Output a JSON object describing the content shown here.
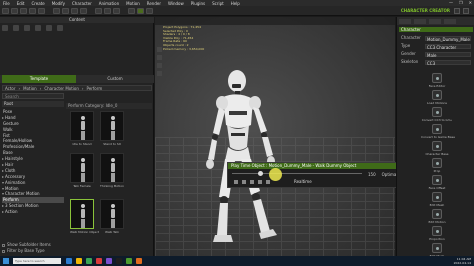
{
  "titlebar": {
    "menus": [
      "File",
      "Edit",
      "Create",
      "Modify",
      "Character",
      "Animation",
      "Motion",
      "Render",
      "Window",
      "Plugins",
      "Script",
      "Help"
    ],
    "window_buttons": [
      "—",
      "❐",
      "✕"
    ]
  },
  "toolbar": {
    "brand": "CHARACTER CREATOR"
  },
  "left_panel": {
    "title": "Content",
    "tabs": [
      "Template",
      "Custom"
    ],
    "breadcrumb": [
      "Actor",
      "Motion",
      "Character Motion",
      "Perform"
    ],
    "search_placeholder": "Search",
    "tree_header": "Root",
    "tree": [
      {
        "label": "Pose",
        "arrow": "",
        "selected": false
      },
      {
        "label": "Hand",
        "arrow": "▸",
        "selected": false
      },
      {
        "label": "Gesture",
        "arrow": "",
        "selected": false
      },
      {
        "label": "Walk",
        "arrow": "",
        "selected": false
      },
      {
        "label": "Fist",
        "arrow": "",
        "selected": false
      },
      {
        "label": "Female/Hollow",
        "arrow": "",
        "selected": false
      },
      {
        "label": "Profession/Male",
        "arrow": "",
        "selected": false
      },
      {
        "label": "Base",
        "arrow": "",
        "selected": false
      },
      {
        "label": "Hairstyle",
        "arrow": "▸",
        "selected": false
      },
      {
        "label": "Hair",
        "arrow": "▸",
        "selected": false
      },
      {
        "label": "Cloth",
        "arrow": "▸",
        "selected": false
      },
      {
        "label": "Accessory",
        "arrow": "▸",
        "selected": false
      },
      {
        "label": "Animation",
        "arrow": "▾",
        "selected": false
      },
      {
        "label": "Motion",
        "arrow": "▾",
        "selected": false
      },
      {
        "label": "Character Motion",
        "arrow": "▾",
        "selected": false
      },
      {
        "label": "Perform",
        "arrow": "",
        "selected": true
      },
      {
        "label": "3 Section Motion",
        "arrow": "▸",
        "selected": false
      },
      {
        "label": "Action",
        "arrow": "▸",
        "selected": false
      }
    ],
    "sub_breadcrumb": "Perform Category: Idle_0",
    "thumbs": [
      {
        "caption": "Idle to Stand",
        "selected": false
      },
      {
        "caption": "Stand to Sit",
        "selected": false
      },
      {
        "caption": "Talk Female",
        "selected": false
      },
      {
        "caption": "Thinking Motion",
        "selected": false
      },
      {
        "caption": "Walk Motion Object",
        "selected": true
      },
      {
        "caption": "Walk Talk",
        "selected": false
      }
    ],
    "checks": [
      "Show Subfolder Items",
      "Filter by Base Type"
    ]
  },
  "viewport": {
    "info_lines": [
      "Project Polygons : 71,454",
      "Selected Poly : 0",
      "Shaders : 4 / 9 / 8",
      "Visible Poly : 71,454",
      "Frame Rate : 60",
      "Objects count : 2",
      "Picked memory : 3,654,000"
    ]
  },
  "timeline": {
    "title": "Play Time Object : Motion_Dummy_Male - Walk Dummy Object",
    "realtime_label": "Realtime",
    "frame_value": "150",
    "mode_label": "Optimal"
  },
  "right_panel": {
    "section_title": "Character",
    "fields": [
      {
        "label": "Character",
        "value": "Motion_Dummy_Male"
      },
      {
        "label": "Type",
        "value": "CC3 Character"
      },
      {
        "label": "Gender",
        "value": "Male"
      },
      {
        "label": "Skeleton",
        "value": "CC3"
      }
    ],
    "buttons": [
      {
        "label": "Face Editor",
        "row": 0,
        "col": 1
      },
      {
        "label": "Load Motions",
        "row": 1,
        "col": 1
      },
      {
        "label": "Convert CC3 to G3+",
        "row": 2,
        "col": 1
      },
      {
        "label": "Convert to Game Base",
        "row": 3,
        "col": 1
      },
      {
        "label": "Character Base",
        "row": 4,
        "col": 1
      },
      {
        "label": "Prop",
        "row": 5,
        "col": 1
      },
      {
        "label": "Face Offset",
        "row": 6,
        "col": 1
      },
      {
        "label": "Edit Mesh",
        "row": 7,
        "col": 1
      },
      {
        "label": "Edit Motion",
        "row": 8,
        "col": 1
      },
      {
        "label": "Proportion",
        "row": 9,
        "col": 1
      },
      {
        "label": "Edit Mesh",
        "row": 10,
        "col": 1
      }
    ]
  },
  "taskbar": {
    "search_text": "Type here to search",
    "time": "11:04 AM",
    "date": "2022-04-14",
    "icon_colors": [
      "#2d7dd2",
      "#f2b705",
      "#3aa655",
      "#d93b3b",
      "#7b4fd1",
      "#1e1e1e",
      "#4c9b2e",
      "#e06c1f"
    ]
  }
}
